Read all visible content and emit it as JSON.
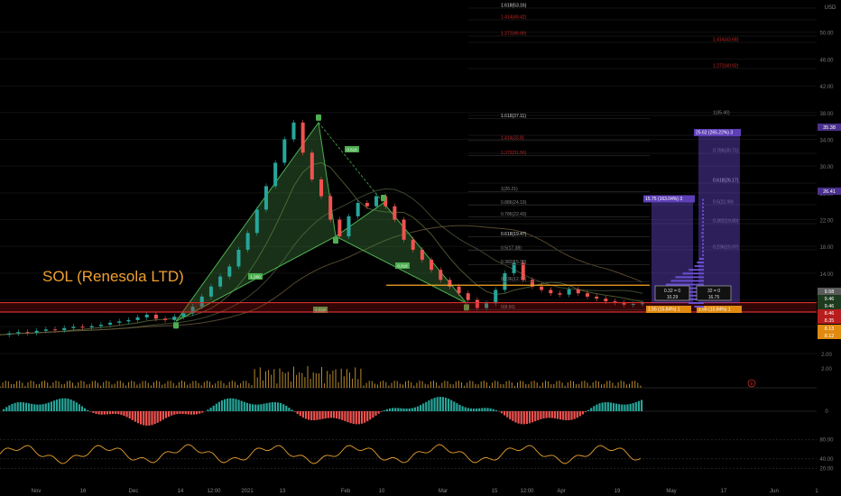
{
  "chart_data": {
    "type": "line",
    "title": "SOL (Renesola LTD)",
    "currency": "USD",
    "price_scale": {
      "ticks": [
        "50.00",
        "46.00",
        "42.00",
        "38.00",
        "34.00",
        "30.00",
        "26.00",
        "22.00",
        "18.00",
        "14.00",
        "10.00",
        "6.00",
        "2.00"
      ],
      "ylim": [
        2,
        54
      ],
      "badges": [
        {
          "text": "35.38",
          "color": "#4a2f8a"
        },
        {
          "text": "26.41",
          "color": "#4a2f8a"
        },
        {
          "text": "9.58",
          "color": "#5a5a5a"
        },
        {
          "text": "9.46",
          "color": "#1e3a1e"
        },
        {
          "text": "9.46",
          "color": "#1e3a1e"
        },
        {
          "text": "8.46",
          "color": "#b81d1d"
        },
        {
          "text": "8.35",
          "color": "#b81d1d"
        },
        {
          "text": "8.13",
          "color": "#e08a10"
        },
        {
          "text": "8.12",
          "color": "#e08a10"
        }
      ]
    },
    "time_axis": [
      "Nov",
      "16",
      "Dec",
      "14",
      "12:00",
      "2021",
      "13",
      "Feb",
      "10",
      "Mar",
      "15",
      "12:00",
      "Apr",
      "19",
      "May",
      "17",
      "Jun",
      "1"
    ],
    "price_series": [
      4.8,
      5.0,
      5.2,
      5.1,
      5.4,
      5.6,
      5.5,
      5.8,
      6.0,
      5.9,
      6.1,
      6.3,
      6.6,
      6.8,
      7.0,
      7.4,
      7.8,
      7.2,
      7.0,
      7.5,
      8.0,
      9.0,
      10.5,
      12.0,
      13.5,
      15.0,
      17.5,
      20.0,
      23.5,
      27.0,
      30.5,
      34.0,
      36.5,
      32.0,
      28.0,
      25.5,
      22.0,
      19.5,
      22.5,
      24.5,
      24.0,
      25.5,
      24.0,
      22.0,
      19.0,
      17.5,
      16.0,
      14.5,
      13.0,
      12.0,
      11.0,
      10.0,
      8.8,
      9.5,
      11.5,
      14.0,
      15.5,
      13.0,
      12.0,
      11.5,
      11.0,
      10.8,
      11.6,
      11.0,
      10.5,
      10.2,
      9.8,
      9.6,
      9.3,
      9.4,
      9.5
    ],
    "harmonic_pattern": {
      "labels": [
        "X",
        "A",
        "B",
        "C",
        "D"
      ],
      "ratios": [
        "1.260",
        "0.618",
        "0.918",
        "1.618"
      ],
      "prices": [
        6.8,
        36.5,
        19.5,
        24.5,
        9.5
      ]
    },
    "fib_levels_lower": [
      "1.618(37.11)",
      "1.414(33.8)",
      "1.272(31.56)",
      "1(26.21)",
      "0.886(24.19)",
      "0.786(22.43)",
      "0.618(19.47)",
      "0.5(17.38)",
      "0.382(15.30)",
      "0.236(12.71)",
      "0(8.56)"
    ],
    "fib_levels_upper": [
      "1.618(53.16)",
      "1.414(49.42)",
      "1.272(46.66)",
      "1.414(43.68)",
      "1.272(40.92)",
      "1(35.40)",
      "0.886(33.40)",
      "0.786(30.71)",
      "0.618(26.17)",
      "0.5(22.99)",
      "0.382(19.80)",
      "0.236(15.97)"
    ],
    "measure_boxes": [
      {
        "top": "15.75 (163.04%) 3",
        "bottom": "1.55 (15.84%) 1"
      },
      {
        "top": "25.62 (265.22%) 3",
        "bottom": "1.55 (15.84%) 1"
      }
    ],
    "info_boxes": [
      {
        "line1": "0.32 = 0",
        "line2": "10.29"
      },
      {
        "line1": "32 = 0",
        "line2": "16.75"
      }
    ],
    "volume_axis": [
      "2.00"
    ],
    "volume_marker": "E",
    "macd_axis": [
      "0"
    ],
    "rsi_axis": [
      "80.00",
      "40.00",
      "20.00"
    ]
  }
}
